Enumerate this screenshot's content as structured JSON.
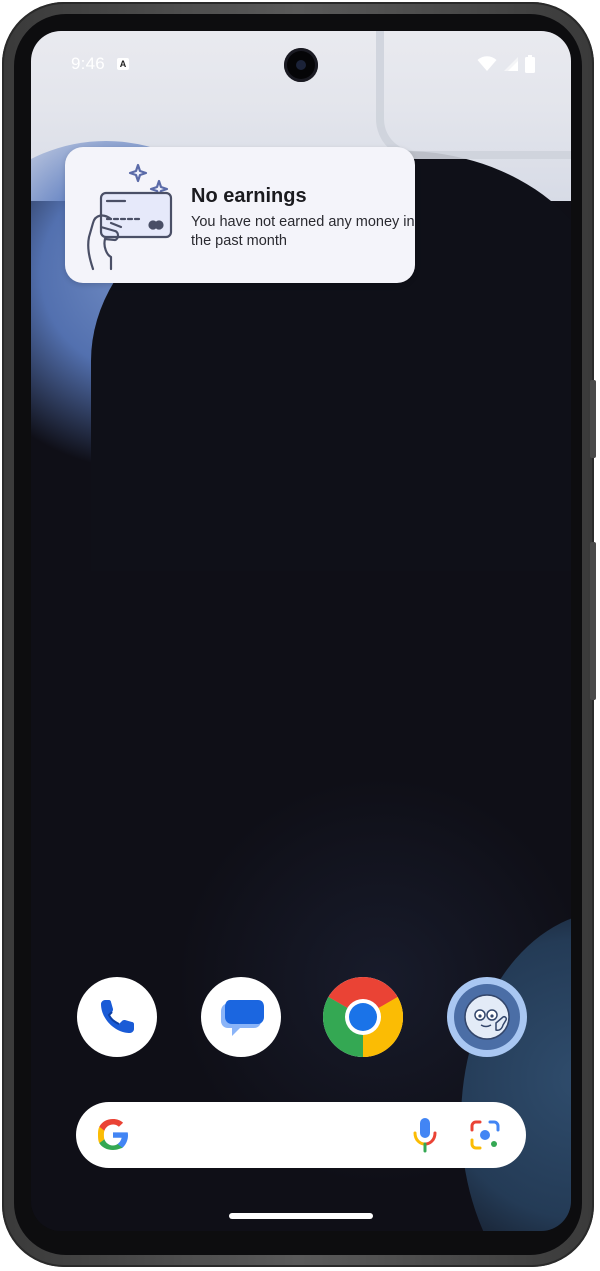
{
  "status_bar": {
    "time": "9:46",
    "notification_icon": "a-box-icon",
    "icons": [
      "wifi-icon",
      "signal-icon",
      "battery-icon"
    ]
  },
  "widget": {
    "icon": "hand-card-icon",
    "title": "No earnings",
    "subtitle": "You have not earned any money in the past month"
  },
  "dock": {
    "apps": [
      {
        "name": "Phone",
        "icon": "phone-icon"
      },
      {
        "name": "Messages",
        "icon": "messages-icon"
      },
      {
        "name": "Chrome",
        "icon": "chrome-icon"
      },
      {
        "name": "Companion app",
        "icon": "face-icon"
      }
    ]
  },
  "search_bar": {
    "logo": "google-g-icon",
    "voice": "mic-icon",
    "lens": "lens-icon"
  },
  "colors": {
    "google_blue": "#4285F4",
    "google_red": "#EA4335",
    "google_yellow": "#FBBC04",
    "google_green": "#34A853",
    "widget_bg": "#f4f4fa"
  }
}
